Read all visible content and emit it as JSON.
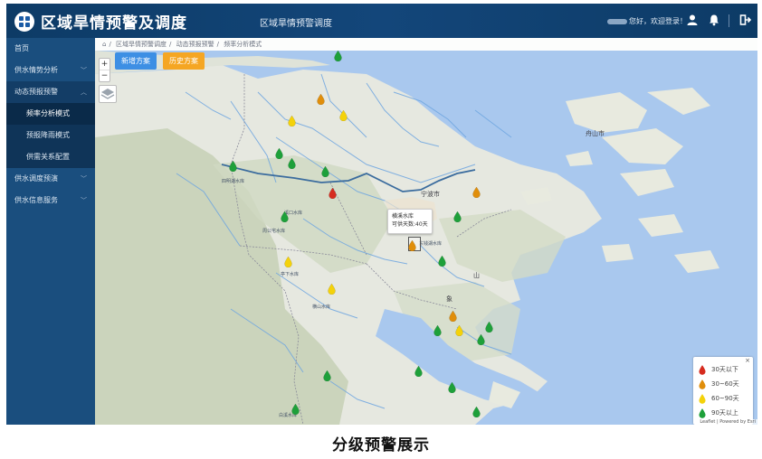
{
  "header": {
    "app_title": "区域旱情预警及调度",
    "center_title": "区域旱情预警调度",
    "greeting": "您好，欢迎登录！",
    "icons": [
      "user-icon",
      "bell-icon",
      "logout-icon"
    ]
  },
  "sidebar": {
    "items": [
      {
        "label": "首页"
      },
      {
        "label": "供水情势分析"
      },
      {
        "label": "动态预报预警"
      },
      {
        "label": "频率分析模式"
      },
      {
        "label": "预报降雨模式"
      },
      {
        "label": "供需关系配置"
      },
      {
        "label": "供水调度预演"
      },
      {
        "label": "供水信息服务"
      }
    ]
  },
  "breadcrumb": {
    "items": [
      "区域旱情预警调度",
      "动态预报预警",
      "频率分析模式"
    ]
  },
  "toolbar": {
    "new_label": "新增方案",
    "history_label": "历史方案"
  },
  "zoom": {
    "in": "+",
    "out": "−"
  },
  "map": {
    "place_labels": [
      {
        "text": "宁波市"
      },
      {
        "text": "舟山市"
      },
      {
        "text": "溪口水库"
      },
      {
        "text": "周公宅水库"
      },
      {
        "text": "亭下水库"
      },
      {
        "text": "横山水库"
      },
      {
        "text": "白溪水库"
      },
      {
        "text": "东钱湖水库"
      },
      {
        "text": "四明湖水库"
      },
      {
        "text": "象"
      },
      {
        "text": "山"
      }
    ],
    "popup": {
      "line1": "横溪水库",
      "line2": "可供天数:40天"
    }
  },
  "legend": {
    "close": "×",
    "items": [
      {
        "label": "30天以下",
        "color": "#d62c1f"
      },
      {
        "label": "30~60天",
        "color": "#e08e0b"
      },
      {
        "label": "60~90天",
        "color": "#f4d20a"
      },
      {
        "label": "90天以上",
        "color": "#1ea03a"
      }
    ]
  },
  "attribution": "Leaflet | Powered by Esri",
  "caption": "分级预警展示"
}
